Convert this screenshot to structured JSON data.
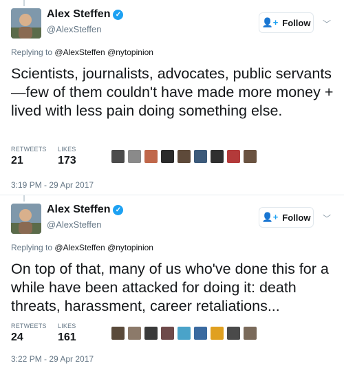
{
  "tweets": [
    {
      "author": {
        "name": "Alex Steffen",
        "handle": "@AlexSteffen"
      },
      "follow_label": "Follow",
      "reply_prefix": "Replying to",
      "reply_mentions": "@AlexSteffen @nytopinion",
      "text": "Scientists, journalists, advocates, public servants—few of them couldn't have made more money + lived with less pain doing something else.",
      "stats": {
        "retweets_label": "RETWEETS",
        "retweets": "21",
        "likes_label": "LIKES",
        "likes": "173"
      },
      "timestamp": "3:19 PM - 29 Apr 2017",
      "liker_colors": [
        "#4b4b4b",
        "#8a8a8a",
        "#c0674a",
        "#2b2b2b",
        "#5e4a3a",
        "#3c5a7a",
        "#2f2f2f",
        "#b33a3a",
        "#6a5240"
      ]
    },
    {
      "author": {
        "name": "Alex Steffen",
        "handle": "@AlexSteffen"
      },
      "follow_label": "Follow",
      "reply_prefix": "Replying to",
      "reply_mentions": "@AlexSteffen @nytopinion",
      "text": "On top of that, many of us who've done this for a while have been attacked for doing it: death threats, harassment, career retaliations...",
      "stats": {
        "retweets_label": "RETWEETS",
        "retweets": "24",
        "likes_label": "LIKES",
        "likes": "161"
      },
      "timestamp": "3:22 PM - 29 Apr 2017",
      "liker_colors": [
        "#5a4a3a",
        "#8c7a6a",
        "#3a3a3a",
        "#6e4a4a",
        "#4aa3c9",
        "#3a6aa0",
        "#e0a020",
        "#4a4a4a",
        "#7a6a5a"
      ]
    }
  ],
  "colors": {
    "accent": "#1da1f2",
    "text": "#14171a",
    "muted": "#657786",
    "border": "#e1e8ed"
  }
}
